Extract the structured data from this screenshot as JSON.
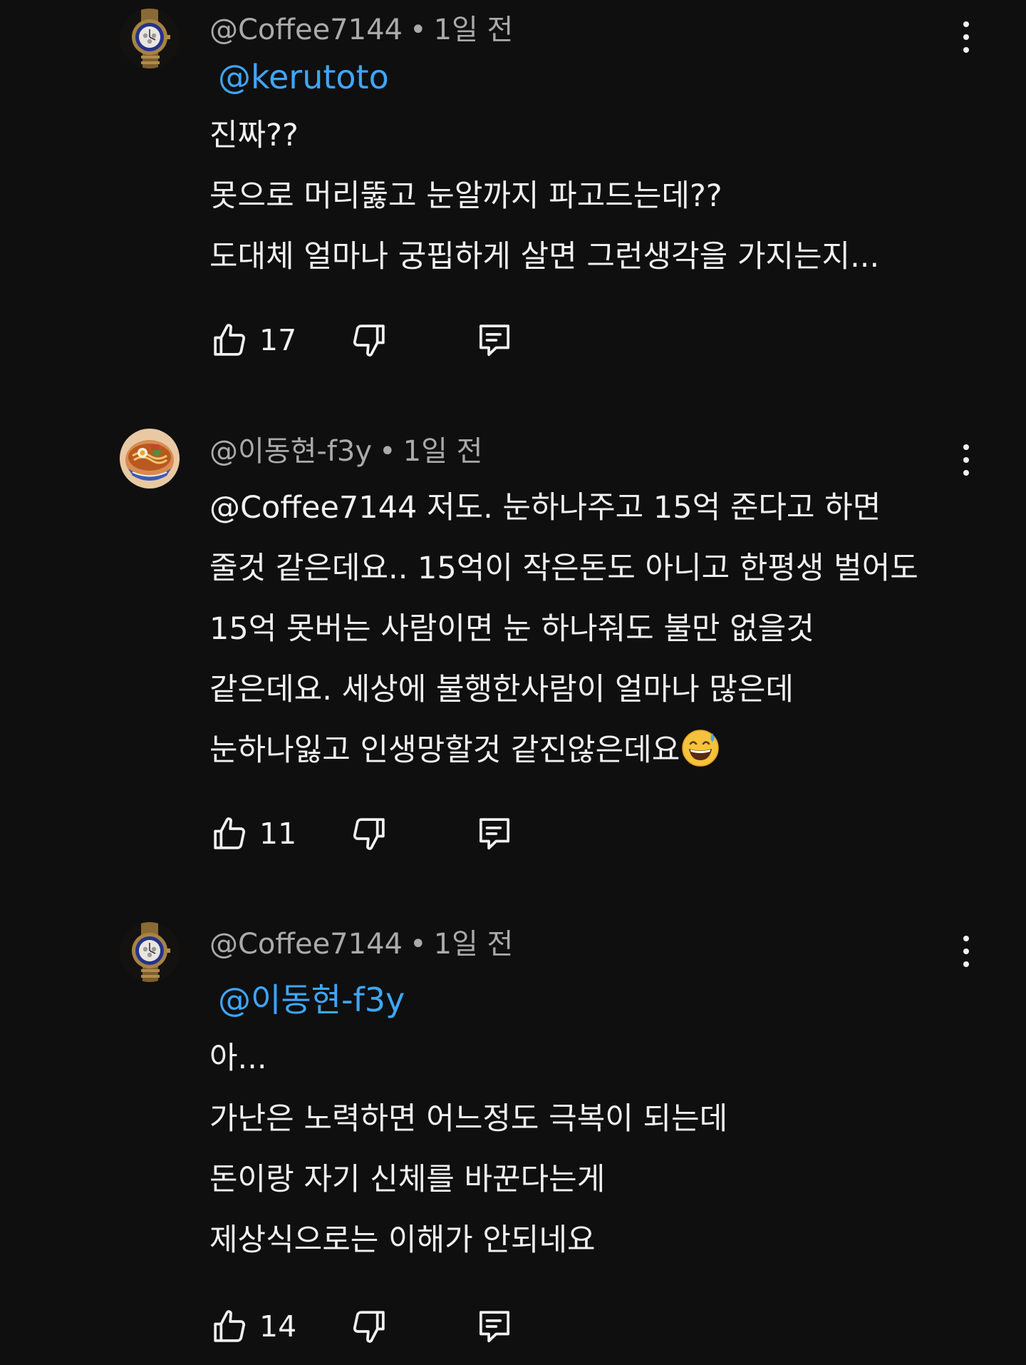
{
  "comments": [
    {
      "author": "@Coffee7144",
      "time": "1일 전",
      "mention": "@kerutoto",
      "lines": [
        "진짜??",
        "못으로 머리뚫고 눈알까지 파고드는데??",
        "도대체 얼마나 궁핍하게 살면 그런생각을 가지는지..."
      ],
      "likes": "17",
      "avatar_icon": "watch-avatar"
    },
    {
      "author": "@이동현-f3y",
      "time": "1일 전",
      "lines": [
        "@Coffee7144 저도. 눈하나주고 15억 준다고 하면",
        "줄것 같은데요.. 15억이 작은돈도 아니고 한평생 벌어도",
        "15억 못버는 사람이면 눈 하나줘도 불만 없을것",
        "같은데요. 세상에 불행한사람이 얼마나 많은데",
        "눈하나잃고 인생망할것 같진않은데요"
      ],
      "trailing_emoji": "sweat-smile-emoji",
      "likes": "11",
      "avatar_icon": "ramen-bowl-avatar"
    },
    {
      "author": "@Coffee7144",
      "time": "1일 전",
      "mention": "@이동현-f3y",
      "lines": [
        "아...",
        "가난은 노력하면 어느정도 극복이 되는데",
        "돈이랑 자기 신체를 바꾼다는게",
        "제상식으로는 이해가 안되네요"
      ],
      "likes": "14",
      "avatar_icon": "watch-avatar"
    }
  ],
  "separator": "•",
  "colors": {
    "background": "#0f0f0f",
    "text": "#f1f1f1",
    "meta": "#aaaaaa",
    "mention": "#3ea6ff"
  },
  "icons": {
    "like": "thumbs-up-icon",
    "dislike": "thumbs-down-icon",
    "reply": "reply-comment-icon",
    "more": "more-vert-icon"
  }
}
